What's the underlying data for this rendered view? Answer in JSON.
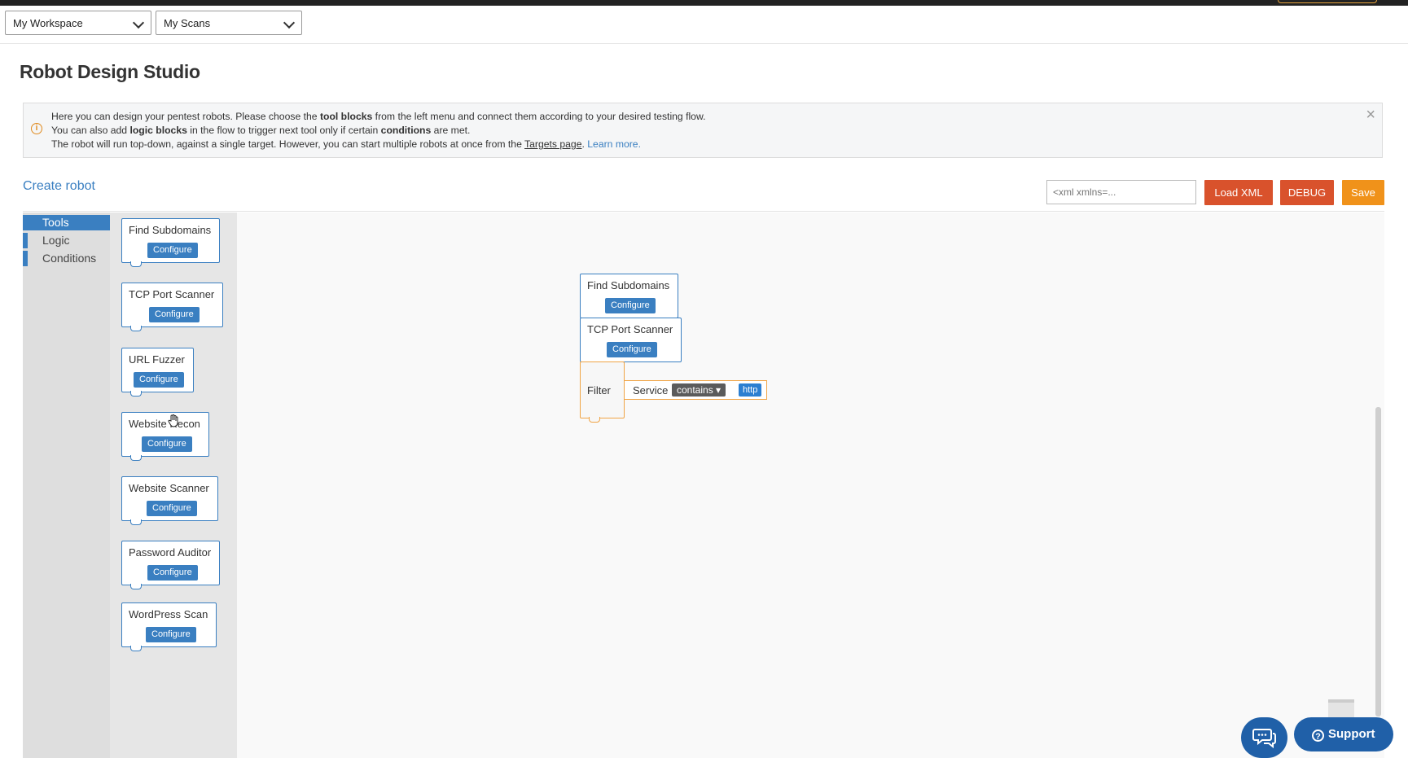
{
  "header": {
    "workspace_select": "My Workspace",
    "scans_select": "My Scans"
  },
  "page": {
    "title": "Robot Design Studio"
  },
  "info": {
    "line1_a": "Here you can design your pentest robots. Please choose the ",
    "line1_b": "tool blocks",
    "line1_c": " from the left menu and connect them according to your desired testing flow.",
    "line2_a": "You can also add ",
    "line2_b": "logic blocks",
    "line2_c": " in the flow to trigger next tool only if certain ",
    "line2_d": "conditions",
    "line2_e": " are met.",
    "line3_a": "The robot will run top-down, against a single target. However, you can start multiple robots at once from the ",
    "line3_link": "Targets page",
    "line3_b": ". ",
    "line3_learn": "Learn more.",
    "close": "×"
  },
  "toolbar": {
    "create_robot": "Create robot",
    "xml_placeholder": "<xml xmlns=...",
    "load_xml": "Load XML",
    "debug": "DEBUG",
    "save": "Save"
  },
  "categories": [
    "Tools",
    "Logic",
    "Conditions"
  ],
  "flyout_tools": [
    {
      "label": "Find Subdomains",
      "configure": "Configure"
    },
    {
      "label": "TCP Port Scanner",
      "configure": "Configure"
    },
    {
      "label": "URL Fuzzer",
      "configure": "Configure"
    },
    {
      "label": "Website Recon",
      "configure": "Configure"
    },
    {
      "label": "Website Scanner",
      "configure": "Configure"
    },
    {
      "label": "Password Auditor",
      "configure": "Configure"
    },
    {
      "label": "WordPress Scan",
      "configure": "Configure"
    }
  ],
  "canvas": {
    "block1": {
      "label": "Find Subdomains",
      "configure": "Configure"
    },
    "block2": {
      "label": "TCP Port Scanner",
      "configure": "Configure"
    },
    "filter": {
      "label": "Filter",
      "field": "Service",
      "operator": "contains ▾",
      "value": "http"
    }
  },
  "support": {
    "label": "Support"
  }
}
